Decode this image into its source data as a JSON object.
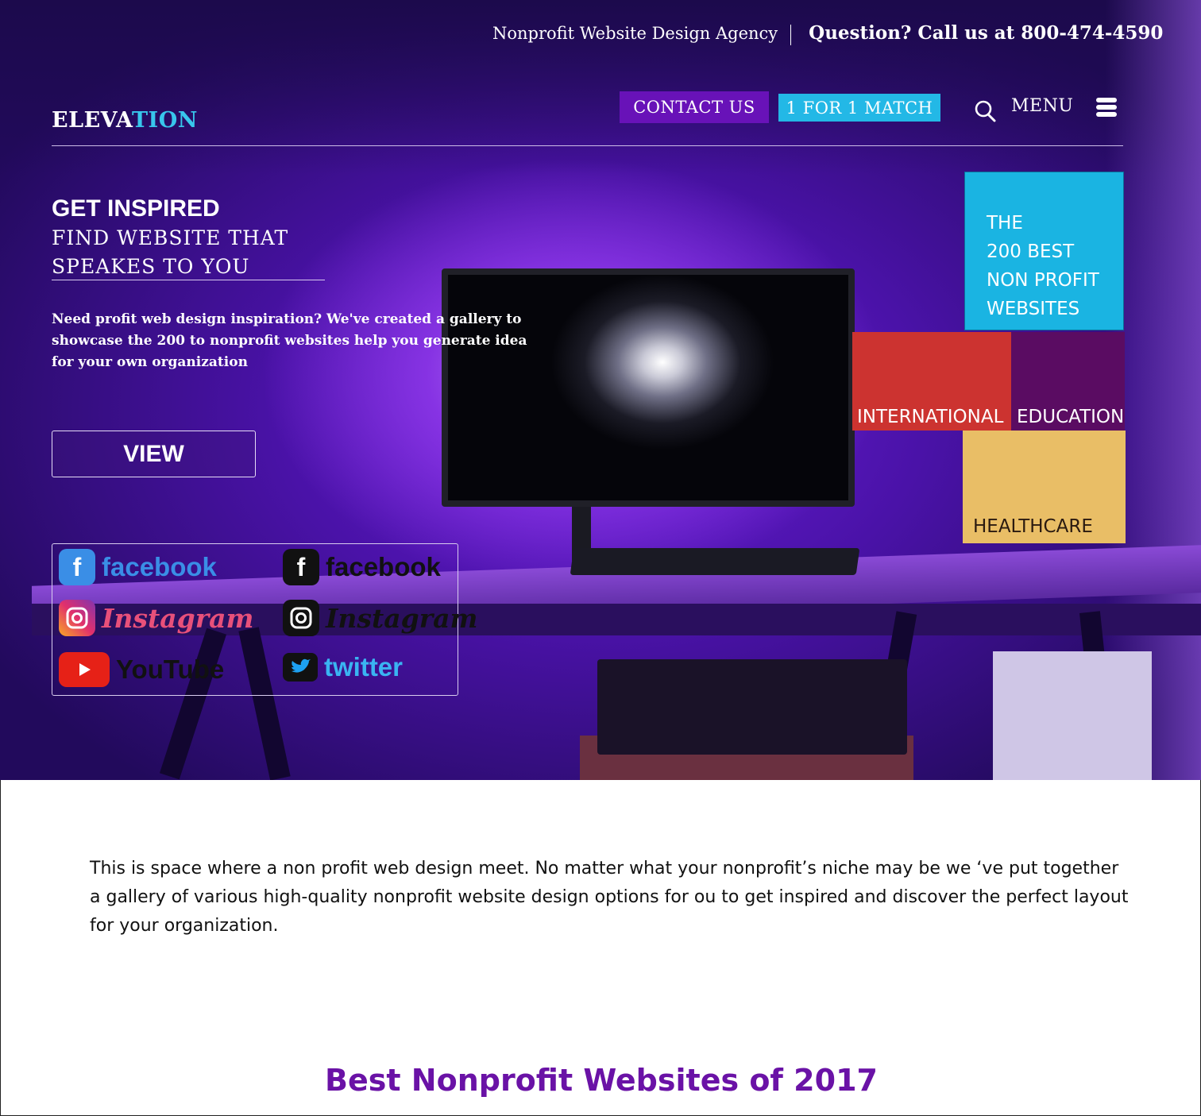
{
  "header": {
    "tagline": "Nonprofit Website Design Agency",
    "phone_line": "Question? Call us at 800-474-4590"
  },
  "logo": {
    "part1": "ELEVA",
    "part2": "TION"
  },
  "nav": {
    "contact_label": "CONTACT US",
    "match_label": "1 FOR 1 MATCH",
    "menu_label": "MENU",
    "search_icon": "search-icon",
    "menu_icon": "hamburger-icon"
  },
  "hero": {
    "kicker": "GET INSPIRED",
    "title_line1": "FIND WEBSITE THAT",
    "title_line2": "SPEAKES TO YOU",
    "description": "Need profit web design inspiration? We've created a gallery to showcase the 200 to nonprofit websites help you generate idea for your own organization",
    "view_label": "VIEW"
  },
  "social": [
    {
      "name": "facebook",
      "icon": "facebook-icon",
      "color": "#3a8ee6",
      "style": "color"
    },
    {
      "name": "facebook",
      "icon": "facebook-icon",
      "color": "#111111",
      "style": "mono"
    },
    {
      "name": "Instagram",
      "icon": "instagram-icon",
      "color": "#e1306c",
      "style": "color"
    },
    {
      "name": "Instagram",
      "icon": "instagram-icon",
      "color": "#111111",
      "style": "mono"
    },
    {
      "name": "YouTube",
      "icon": "youtube-icon",
      "color": "#e62117",
      "style": "color"
    },
    {
      "name": "twitter",
      "icon": "twitter-icon",
      "color": "#1da1f2",
      "style": "mono"
    }
  ],
  "tiles": {
    "best_lines": [
      "THE",
      "200 BEST",
      "NON PROFIT",
      "WEBSITES"
    ],
    "international": "INTERNATIONAL",
    "education": "EDUCATION",
    "healthcare": "HEALTHCARE"
  },
  "content": {
    "intro": "This is space where a  non profit  web design  meet. No matter  what your nonprofit’s niche may be we ‘ve put together a gallery of various high-quality nonprofit website design options for ou to get inspired and discover the perfect layout for your organization.",
    "section_title": "Best Nonprofit Websites of 2017"
  },
  "colors": {
    "accent_cyan": "#1ab4e2",
    "accent_purple": "#6812b8",
    "title_purple": "#6a12a6",
    "tile_red": "#cc3330",
    "tile_plum": "#5a0c62",
    "tile_gold": "#e9be66"
  }
}
